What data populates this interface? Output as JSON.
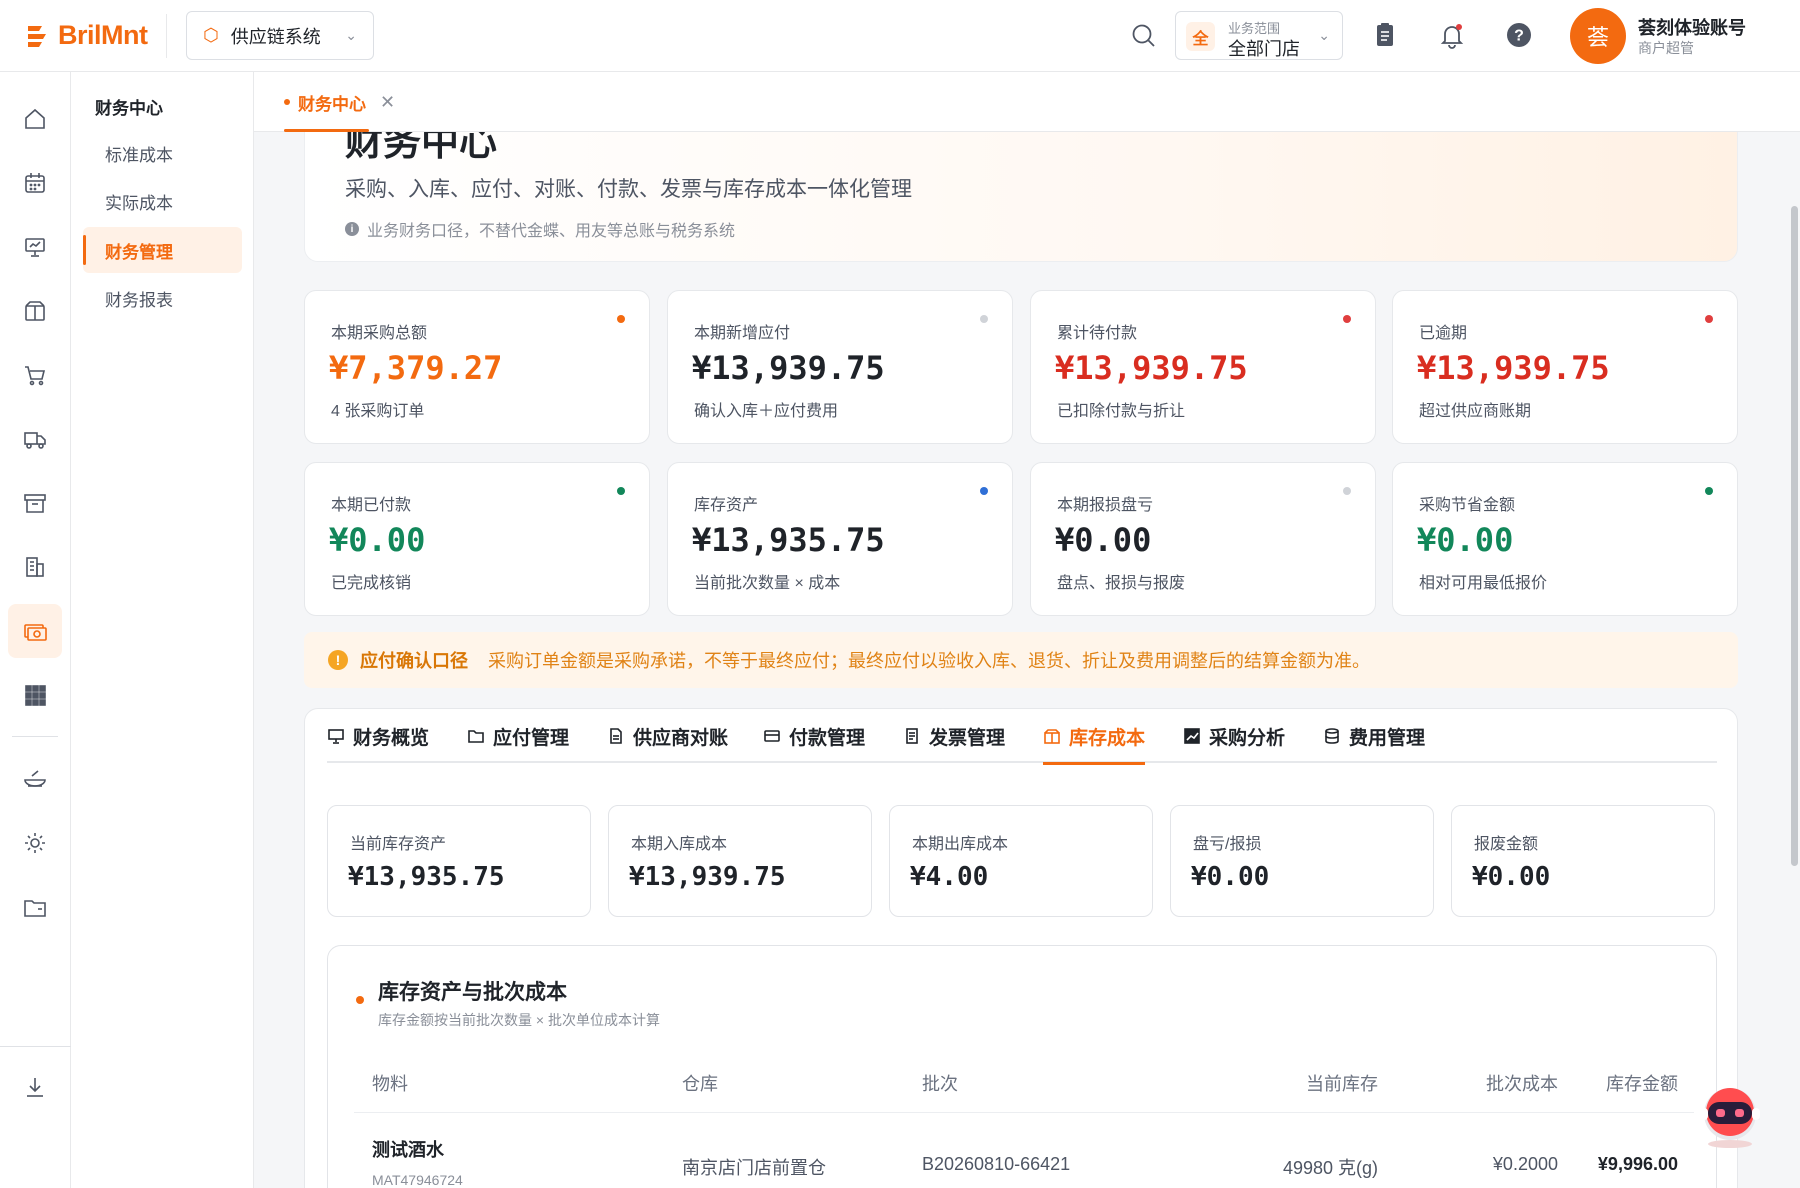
{
  "header": {
    "brand": "BrilMnt",
    "system_select": "供应链系统",
    "scope_label": "业务范围",
    "scope_badge": "全",
    "scope_value": "全部门店",
    "avatar_char": "荟",
    "user_name": "荟刻体验账号",
    "user_role": "商户超管"
  },
  "submenu": {
    "title": "财务中心",
    "items": [
      "标准成本",
      "实际成本",
      "财务管理",
      "财务报表"
    ],
    "active_index": 2
  },
  "tabstrip": {
    "active_tab": "财务中心"
  },
  "hero": {
    "title": "财务中心",
    "subtitle": "采购、入库、应付、对账、付款、发票与库存成本一体化管理",
    "note": "业务财务口径，不替代金蝶、用友等总账与税务系统"
  },
  "kpis": [
    {
      "label": "本期采购总额",
      "value": "¥7,379.27",
      "desc": "4 张采购订单",
      "color": "#f36a10",
      "dot": "#f36a10"
    },
    {
      "label": "本期新增应付",
      "value": "¥13,939.75",
      "desc": "确认入库＋应付费用",
      "color": "#1f2329",
      "dot": "#d0d3d8"
    },
    {
      "label": "累计待付款",
      "value": "¥13,939.75",
      "desc": "已扣除付款与折让",
      "color": "#d92d20",
      "dot": "#e03e3e"
    },
    {
      "label": "已逾期",
      "value": "¥13,939.75",
      "desc": "超过供应商账期",
      "color": "#d92d20",
      "dot": "#e03e3e"
    },
    {
      "label": "本期已付款",
      "value": "¥0.00",
      "desc": "已完成核销",
      "color": "#12875a",
      "dot": "#12875a"
    },
    {
      "label": "库存资产",
      "value": "¥13,935.75",
      "desc": "当前批次数量 × 成本",
      "color": "#1f2329",
      "dot": "#2f6fd6"
    },
    {
      "label": "本期报损盘亏",
      "value": "¥0.00",
      "desc": "盘点、报损与报废",
      "color": "#1f2329",
      "dot": "#d0d3d8"
    },
    {
      "label": "采购节省金额",
      "value": "¥0.00",
      "desc": "相对可用最低报价",
      "color": "#12875a",
      "dot": "#12875a"
    }
  ],
  "alert": {
    "title": "应付确认口径",
    "message": "采购订单金额是采购承诺，不等于最终应付；最终应付以验收入库、退货、折让及费用调整后的结算金额为准。"
  },
  "tabs": [
    "财务概览",
    "应付管理",
    "供应商对账",
    "付款管理",
    "发票管理",
    "库存成本",
    "采购分析",
    "费用管理"
  ],
  "active_tab_index": 5,
  "mini_stats": [
    {
      "label": "当前库存资产",
      "value": "¥13,935.75"
    },
    {
      "label": "本期入库成本",
      "value": "¥13,939.75"
    },
    {
      "label": "本期出库成本",
      "value": "¥4.00"
    },
    {
      "label": "盘亏/报损",
      "value": "¥0.00"
    },
    {
      "label": "报废金额",
      "value": "¥0.00"
    }
  ],
  "inventory_table": {
    "title": "库存资产与批次成本",
    "subtitle": "库存金额按当前批次数量 × 批次单位成本计算",
    "columns": [
      "物料",
      "仓库",
      "批次",
      "当前库存",
      "批次成本",
      "库存金额"
    ],
    "rows": [
      {
        "name": "测试酒水",
        "code": "MAT47946724",
        "warehouse": "南京店门店前置仓",
        "batch": "B20260810-66421",
        "stock": "49980 克(g)",
        "cost": "¥0.2000",
        "amount": "¥9,996.00"
      }
    ]
  }
}
